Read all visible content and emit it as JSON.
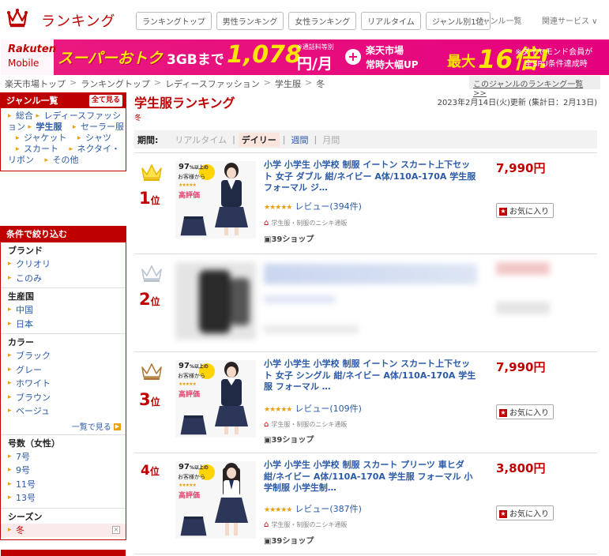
{
  "header": {
    "title": "ランキング",
    "nav": [
      "ランキングトップ",
      "男性ランキング",
      "女性ランキング",
      "リアルタイム",
      "ジャンル別1位"
    ],
    "genre_link": "ジャンル一覧",
    "services": "関連サービス ∨"
  },
  "banner": {
    "brand_line1": "Rakuten",
    "brand_line2": "Mobile",
    "headline": "スーパーおトク",
    "plan": "3GBまで",
    "price": "1,078",
    "tax_note": "※通話料等別",
    "price_unit": "円/月",
    "plus": "+",
    "market_line1": "楽天市場",
    "market_line2": "常時大幅UP",
    "max": "最大",
    "multiplier": "16倍!",
    "diamond_line1": "※ダイヤモンド会員が",
    "diamond_line2": "全SPU条件達成時"
  },
  "breadcrumb": [
    "楽天市場トップ",
    "ランキングトップ",
    "レディースファッション",
    "学生服",
    "冬"
  ],
  "genre_ranking_link": "このジャンルのランキング一覧 >>",
  "sidebar": {
    "genre_title": "ジャンル一覧",
    "see_all": "全て見る",
    "genres": [
      {
        "label": "総合",
        "sub": false
      },
      {
        "label": "レディースファッション",
        "sub": false
      },
      {
        "label": "学生服",
        "sub": false
      },
      {
        "label": "セーラー服",
        "sub": true
      },
      {
        "label": "ジャケット",
        "sub": true
      },
      {
        "label": "シャツ",
        "sub": true
      },
      {
        "label": "スカート",
        "sub": true
      },
      {
        "label": "ネクタイ・リボン",
        "sub": true
      },
      {
        "label": "その他",
        "sub": true
      }
    ],
    "filter_title": "条件で絞り込む",
    "groups": {
      "brand": {
        "title": "ブランド",
        "items": [
          "クリオリ",
          "このみ"
        ]
      },
      "origin": {
        "title": "生産国",
        "items": [
          "中国",
          "日本"
        ]
      },
      "color": {
        "title": "カラー",
        "items": [
          "ブラック",
          "グレー",
          "ホワイト",
          "ブラウン",
          "ベージュ"
        ],
        "more": "一覧で見る"
      },
      "size": {
        "title": "号数（女性）",
        "items": [
          "7号",
          "9号",
          "11号",
          "13号"
        ]
      },
      "season": {
        "title": "シーズン",
        "selected": "冬",
        "clear": "×"
      }
    }
  },
  "main": {
    "title": "学生服ランキング",
    "subtitle": "冬",
    "updated": "2023年2月14日(火)更新 (集計日：2月13日)",
    "period_label": "期間:",
    "periods": [
      "リアルタイム",
      "デイリー",
      "週間",
      "月間"
    ],
    "items": [
      {
        "rank": "1",
        "rank_suffix": "位",
        "name": "小学 小学生 小学校 制服 イートン スカート上下セット 女子 ダブル 紺/ネイビー A体/110A-170A 学生服 フォーマル ジ…",
        "price": "7,990円",
        "stars": "★★★★★",
        "reviews": "レビュー(394件)",
        "shop": "学生服・制服のニシキ通販",
        "s39": "39ショップ",
        "fav": "お気に入り",
        "crown_color": "#e8b800"
      },
      {
        "rank": "2",
        "rank_suffix": "位",
        "name": "",
        "price": "",
        "crown_color": "#b8c4d0"
      },
      {
        "rank": "3",
        "rank_suffix": "位",
        "name": "小学 小学生 小学校 制服 イートン スカート上下セット 女子 シングル 紺/ネイビー A体/110A-170A 学生服 フォーマル …",
        "price": "7,990円",
        "stars": "★★★★★",
        "reviews": "レビュー(109件)",
        "shop": "学生服・制服のニシキ通販",
        "s39": "39ショップ",
        "fav": "お気に入り",
        "crown_color": "#b07a3a"
      },
      {
        "rank": "4",
        "rank_suffix": "位",
        "name": "小学 小学生 小学校 制服 スカート プリーツ 車ヒダ 紺/ネイビー A体/110A-170A 学生服 フォーマル 小学制服 小学生制…",
        "price": "3,800円",
        "stars": "★★★★★",
        "reviews": "レビュー(387件)",
        "shop": "学生服・制服のニシキ通販",
        "s39": "39ショップ",
        "fav": "お気に入り"
      }
    ],
    "badge": {
      "pct": "97",
      "pct_suffix": "%以上の",
      "line2": "お客様から",
      "stars": "★★★★★",
      "line3": "高評価"
    }
  },
  "colors": {
    "brand_red": "#bf0000",
    "link_blue": "#2a5aa8",
    "banner_pink": "#e5007d",
    "accent_yellow": "#ffe600"
  }
}
